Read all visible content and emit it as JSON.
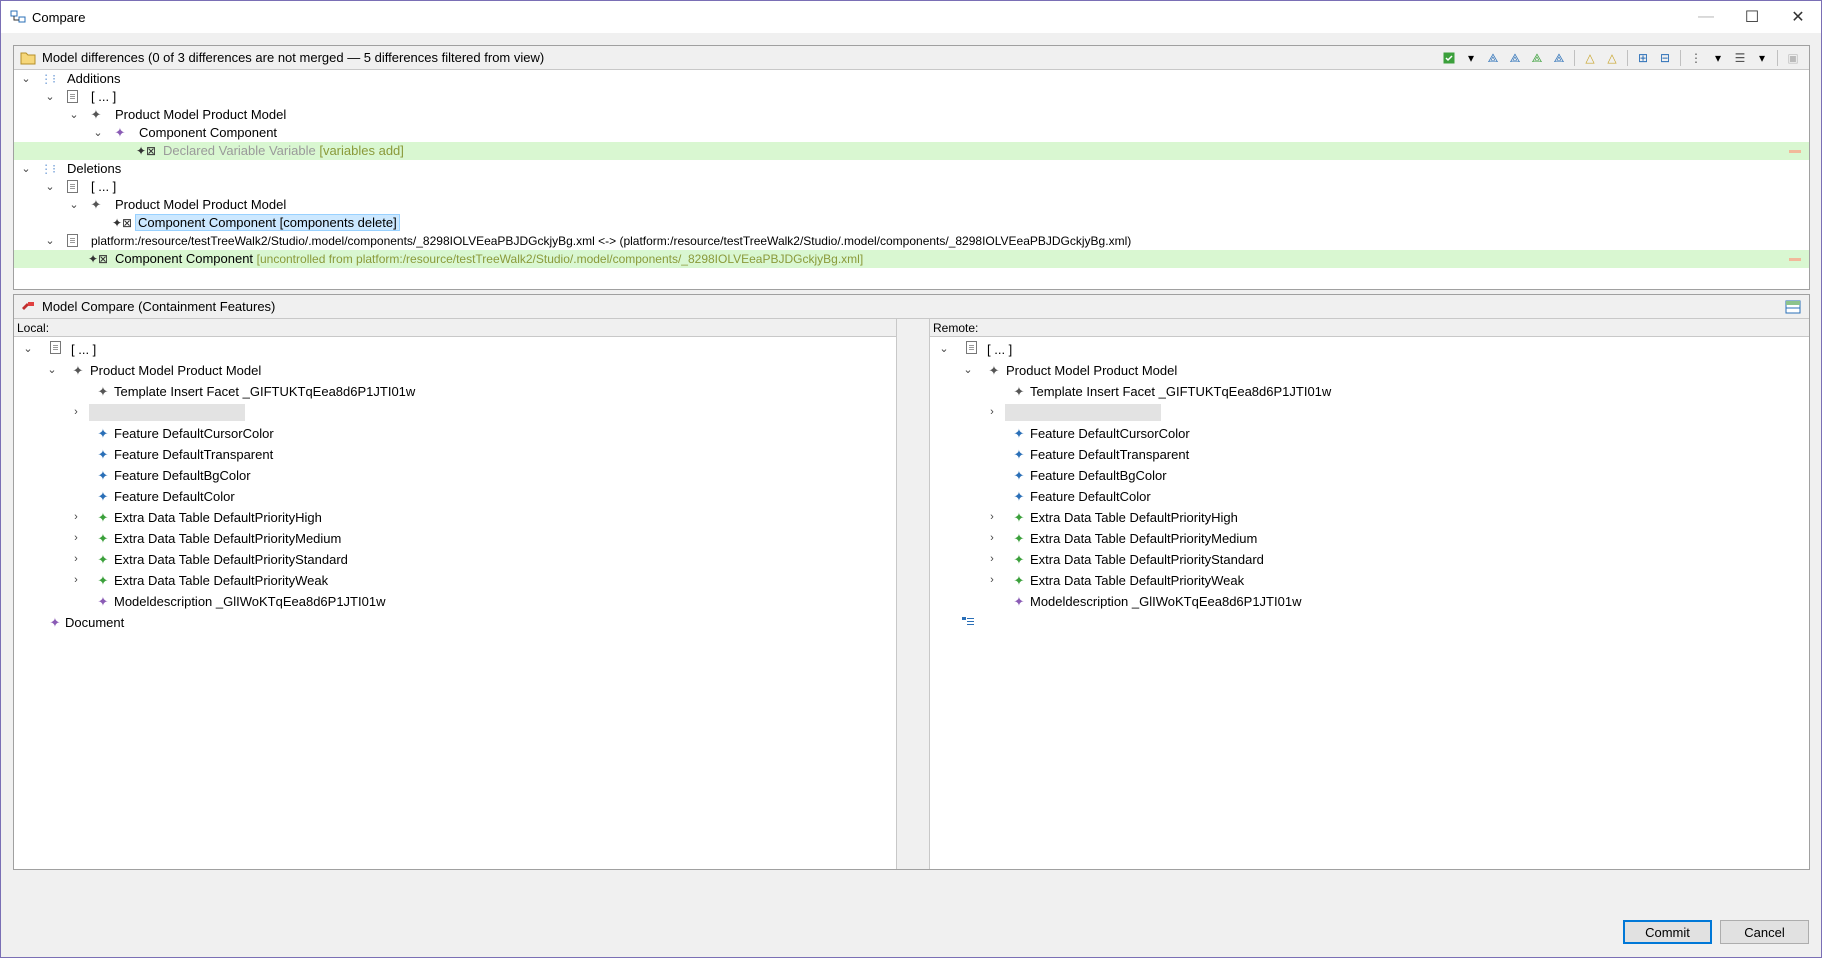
{
  "window": {
    "title": "Compare",
    "minimize": "—",
    "maximize": "☐",
    "close": "✕"
  },
  "differences": {
    "header": "Model differences  (0 of 3 differences are not merged — 5 differences filtered from view)",
    "rows": [
      {
        "label": "Additions"
      },
      {
        "label": "[ ... ]"
      },
      {
        "label": "Product Model Product Model"
      },
      {
        "label": "Component Component"
      },
      {
        "label": "Declared Variable Variable",
        "suffix": "[variables add]"
      },
      {
        "label": "Deletions"
      },
      {
        "label": "[ ... ]"
      },
      {
        "label": "Product Model Product Model"
      },
      {
        "label": "Component Component [components delete]"
      },
      {
        "label": "platform:/resource/testTreeWalk2/Studio/.model/components/_8298IOLVEeaPBJDGckjyBg.xml <->  (platform:/resource/testTreeWalk2/Studio/.model/components/_8298IOLVEeaPBJDGckjyBg.xml)"
      },
      {
        "label": "Component Component",
        "suffix": "[uncontrolled from platform:/resource/testTreeWalk2/Studio/.model/components/_8298IOLVEeaPBJDGckjyBg.xml]"
      }
    ]
  },
  "compare": {
    "header": "Model Compare (Containment Features)",
    "local_label": "Local:",
    "remote_label": "Remote:",
    "local_rows": [
      {
        "label": "[ ... ]"
      },
      {
        "label": "Product Model Product Model"
      },
      {
        "label": "Template Insert Facet _GIFTUKTqEea8d6P1JTI01w"
      },
      {
        "label": ""
      },
      {
        "label": "Feature DefaultCursorColor"
      },
      {
        "label": "Feature DefaultTransparent"
      },
      {
        "label": "Feature DefaultBgColor"
      },
      {
        "label": "Feature DefaultColor"
      },
      {
        "label": "Extra Data Table DefaultPriorityHigh"
      },
      {
        "label": "Extra Data Table DefaultPriorityMedium"
      },
      {
        "label": "Extra Data Table DefaultPriorityStandard"
      },
      {
        "label": "Extra Data Table DefaultPriorityWeak"
      },
      {
        "label": "Modeldescription _GlIWoKTqEea8d6P1JTI01w"
      },
      {
        "label": "Document"
      }
    ],
    "remote_rows": [
      {
        "label": "[ ... ]"
      },
      {
        "label": "Product Model Product Model"
      },
      {
        "label": "Template Insert Facet _GIFTUKTqEea8d6P1JTI01w"
      },
      {
        "label": ""
      },
      {
        "label": "Feature DefaultCursorColor"
      },
      {
        "label": "Feature DefaultTransparent"
      },
      {
        "label": "Feature DefaultBgColor"
      },
      {
        "label": "Feature DefaultColor"
      },
      {
        "label": "Extra Data Table DefaultPriorityHigh"
      },
      {
        "label": "Extra Data Table DefaultPriorityMedium"
      },
      {
        "label": "Extra Data Table DefaultPriorityStandard"
      },
      {
        "label": "Extra Data Table DefaultPriorityWeak"
      },
      {
        "label": "Modeldescription _GlIWoKTqEea8d6P1JTI01w"
      }
    ]
  },
  "buttons": {
    "commit": "Commit",
    "cancel": "Cancel"
  },
  "colors": {
    "added_row": "#d9f7d1",
    "selection": "#cce8ff",
    "marker": "#f2b89a",
    "suffix_text": "#8a9a3a"
  }
}
